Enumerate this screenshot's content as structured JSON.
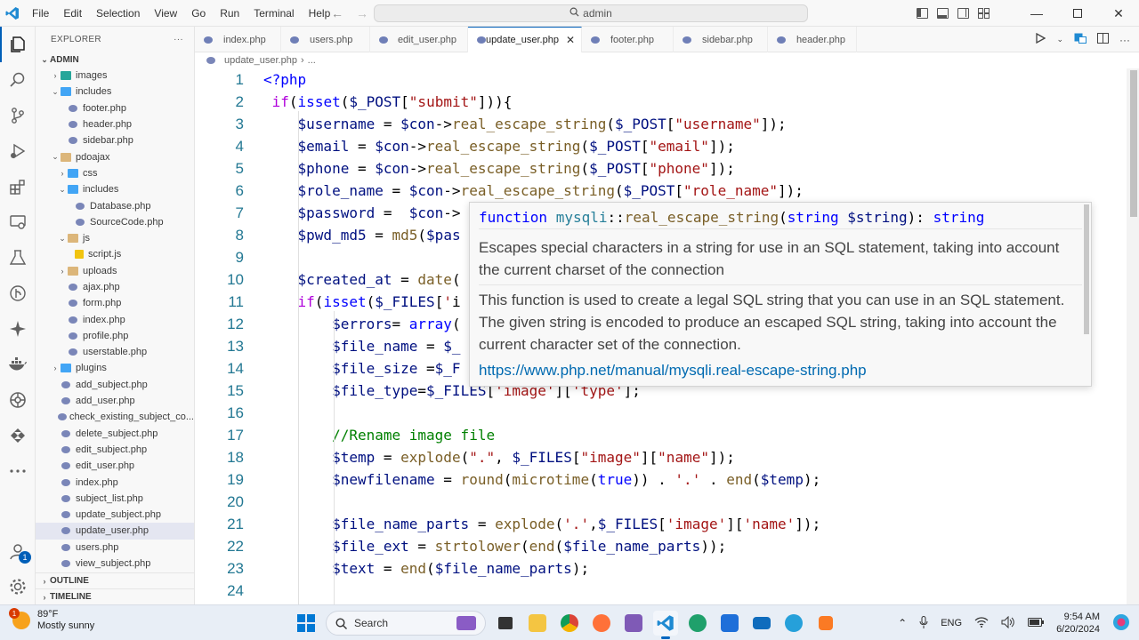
{
  "titlebar": {
    "menu": [
      "File",
      "Edit",
      "Selection",
      "View",
      "Go",
      "Run",
      "Terminal",
      "Help"
    ],
    "command_center": "admin"
  },
  "explorer": {
    "header": "EXPLORER",
    "header_more": "···",
    "root": "ADMIN",
    "tree": [
      {
        "label": "images",
        "depth": 1,
        "type": "folder-teal",
        "chevron": "›"
      },
      {
        "label": "includes",
        "depth": 1,
        "type": "folder-blue",
        "chevron": "⌄"
      },
      {
        "label": "footer.php",
        "depth": 2,
        "type": "php"
      },
      {
        "label": "header.php",
        "depth": 2,
        "type": "php"
      },
      {
        "label": "sidebar.php",
        "depth": 2,
        "type": "php"
      },
      {
        "label": "pdoajax",
        "depth": 1,
        "type": "folder",
        "chevron": "⌄"
      },
      {
        "label": "css",
        "depth": 2,
        "type": "folder-blue",
        "chevron": "›"
      },
      {
        "label": "includes",
        "depth": 2,
        "type": "folder-blue",
        "chevron": "⌄"
      },
      {
        "label": "Database.php",
        "depth": 3,
        "type": "php"
      },
      {
        "label": "SourceCode.php",
        "depth": 3,
        "type": "php"
      },
      {
        "label": "js",
        "depth": 2,
        "type": "folder",
        "chevron": "⌄"
      },
      {
        "label": "script.js",
        "depth": 3,
        "type": "js"
      },
      {
        "label": "uploads",
        "depth": 2,
        "type": "folder",
        "chevron": "›"
      },
      {
        "label": "ajax.php",
        "depth": 2,
        "type": "php"
      },
      {
        "label": "form.php",
        "depth": 2,
        "type": "php"
      },
      {
        "label": "index.php",
        "depth": 2,
        "type": "php"
      },
      {
        "label": "profile.php",
        "depth": 2,
        "type": "php"
      },
      {
        "label": "userstable.php",
        "depth": 2,
        "type": "php"
      },
      {
        "label": "plugins",
        "depth": 1,
        "type": "folder-blue",
        "chevron": "›"
      },
      {
        "label": "add_subject.php",
        "depth": 1,
        "type": "php"
      },
      {
        "label": "add_user.php",
        "depth": 1,
        "type": "php"
      },
      {
        "label": "check_existing_subject_co...",
        "depth": 1,
        "type": "php"
      },
      {
        "label": "delete_subject.php",
        "depth": 1,
        "type": "php"
      },
      {
        "label": "edit_subject.php",
        "depth": 1,
        "type": "php"
      },
      {
        "label": "edit_user.php",
        "depth": 1,
        "type": "php"
      },
      {
        "label": "index.php",
        "depth": 1,
        "type": "php"
      },
      {
        "label": "subject_list.php",
        "depth": 1,
        "type": "php"
      },
      {
        "label": "update_subject.php",
        "depth": 1,
        "type": "php"
      },
      {
        "label": "update_user.php",
        "depth": 1,
        "type": "php",
        "selected": true
      },
      {
        "label": "users.php",
        "depth": 1,
        "type": "php"
      },
      {
        "label": "view_subject.php",
        "depth": 1,
        "type": "php"
      }
    ],
    "outline": "OUTLINE",
    "timeline": "TIMELINE"
  },
  "tabs": [
    {
      "label": "index.php",
      "active": false
    },
    {
      "label": "users.php",
      "active": false
    },
    {
      "label": "edit_user.php",
      "active": false
    },
    {
      "label": "update_user.php",
      "active": true
    },
    {
      "label": "footer.php",
      "active": false
    },
    {
      "label": "sidebar.php",
      "active": false
    },
    {
      "label": "header.php",
      "active": false
    }
  ],
  "breadcrumb": {
    "file": "update_user.php",
    "rest": "..."
  },
  "editor": {
    "lines": [
      "<?php",
      " if(isset($_POST[\"submit\"])){",
      "    $username = $con->real_escape_string($_POST[\"username\"]);",
      "    $email = $con->real_escape_string($_POST[\"email\"]);",
      "    $phone = $con->real_escape_string($_POST[\"phone\"]);",
      "    $role_name = $con->real_escape_string($_POST[\"role_name\"]);",
      "    $password =  $con->",
      "    $pwd_md5 = md5($pas",
      "",
      "    $created_at = date(",
      "    if(isset($_FILES['i",
      "        $errors= array(",
      "        $file_name = $_",
      "        $file_size =$_F",
      "        $file_type=$_FILES['image']['type'];",
      "",
      "        //Rename image file",
      "        $temp = explode(\".\", $_FILES[\"image\"][\"name\"]);",
      "        $newfilename = round(microtime(true)) . '.' . end($temp);",
      "",
      "        $file_name_parts = explode('.',$_FILES['image']['name']);",
      "        $file_ext = strtolower(end($file_name_parts));",
      "        $text = end($file_name_parts);",
      ""
    ]
  },
  "hover": {
    "sig_keyword": "function",
    "sig_class": "mysqli",
    "sig_sep": "::",
    "sig_fn": "real_escape_string",
    "sig_open": "(",
    "sig_type": "string",
    "sig_param": " $string",
    "sig_close": "): ",
    "sig_ret": "string",
    "desc1": "Escapes special characters in a string for use in an SQL statement, taking into account the current charset of the connection",
    "desc2": "This function is used to create a legal SQL string that you can use in an SQL statement. The given string is encoded to produce an escaped SQL string, taking into account the current character set of the connection.",
    "link": "https://www.php.net/manual/mysqli.real-escape-string.php"
  },
  "taskbar": {
    "weather_temp": "89°F",
    "weather_desc": "Mostly sunny",
    "weather_badge": "1",
    "search_label": "Search",
    "lang": "ENG",
    "time": "9:54 AM",
    "date": "6/20/2024"
  },
  "activity": {
    "accounts_badge": "1"
  }
}
